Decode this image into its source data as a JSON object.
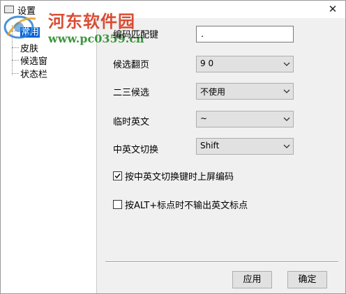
{
  "window": {
    "title": "设置",
    "close_glyph": "✕"
  },
  "sidebar": {
    "items": [
      {
        "label": "常用",
        "selected": true
      },
      {
        "label": "皮肤"
      },
      {
        "label": "候选窗"
      },
      {
        "label": "状态栏"
      }
    ]
  },
  "watermark": {
    "title": "河东软件园",
    "url": "www.pc0359.cn"
  },
  "settings": {
    "match_key": {
      "label": "编码匹配键",
      "value": "."
    },
    "page_key": {
      "label": "候选翻页",
      "value": "9 0"
    },
    "second_third": {
      "label": "二三候选",
      "value": "不使用"
    },
    "temp_english": {
      "label": "临时英文",
      "value": "~"
    },
    "cn_en_switch": {
      "label": "中英文切换",
      "value": "Shift"
    }
  },
  "options": {
    "commit_on_switch": {
      "label": "按中英文切换键时上屏编码",
      "checked": true
    },
    "alt_punct": {
      "label": "按ALT+标点时不输出英文标点",
      "checked": false
    }
  },
  "buttons": {
    "apply": "应用",
    "ok": "确定"
  },
  "colors": {
    "selection": "#0a64d7",
    "watermark_red": "#d63a1d",
    "watermark_green": "#2a8a2a"
  }
}
